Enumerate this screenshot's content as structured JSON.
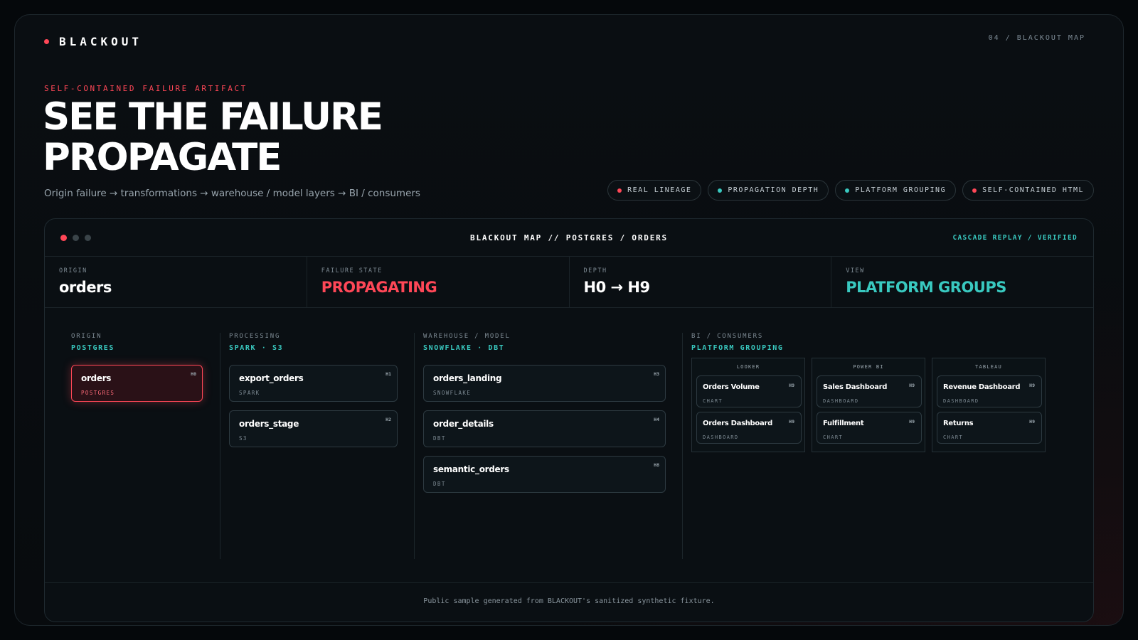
{
  "brand": {
    "name": "BLACKOUT",
    "accent": "#ff4757"
  },
  "page_tag": "04 / BLACKOUT MAP",
  "hero": {
    "eyebrow": "SELF-CONTAINED FAILURE ARTIFACT",
    "title_line1": "SEE THE FAILURE",
    "title_line2": "PROPAGATE",
    "subtitle": "Origin failure → transformations → warehouse / model layers → BI / consumers"
  },
  "pills": [
    {
      "label": "REAL LINEAGE",
      "color": "#ff4757"
    },
    {
      "label": "PROPAGATION DEPTH",
      "color": "#39c9c0"
    },
    {
      "label": "PLATFORM GROUPING",
      "color": "#39c9c0"
    },
    {
      "label": "SELF-CONTAINED HTML",
      "color": "#ff4757"
    }
  ],
  "window": {
    "title": "BLACKOUT MAP // POSTGRES / ORDERS",
    "status": "CASCADE REPLAY / VERIFIED",
    "traffic_colors": [
      "#ff4757",
      "#3a4449",
      "#3a4449"
    ]
  },
  "stats": [
    {
      "label": "ORIGIN",
      "value": "orders",
      "color": "#ffffff"
    },
    {
      "label": "FAILURE STATE",
      "value": "PROPAGATING",
      "color": "#ff4757"
    },
    {
      "label": "DEPTH",
      "value": "H0 → H9",
      "color": "#ffffff"
    },
    {
      "label": "VIEW",
      "value": "PLATFORM GROUPS",
      "color": "#39c9c0"
    }
  ],
  "columns": {
    "origin": {
      "label": "ORIGIN",
      "platform": "POSTGRES",
      "nodes": [
        {
          "name": "orders",
          "type": "POSTGRES",
          "hop": "H0"
        }
      ]
    },
    "processing": {
      "label": "PROCESSING",
      "platform": "SPARK · S3",
      "nodes": [
        {
          "name": "export_orders",
          "type": "SPARK",
          "hop": "H1"
        },
        {
          "name": "orders_stage",
          "type": "S3",
          "hop": "H2"
        }
      ]
    },
    "warehouse": {
      "label": "WAREHOUSE / MODEL",
      "platform": "SNOWFLAKE · DBT",
      "nodes": [
        {
          "name": "orders_landing",
          "type": "SNOWFLAKE",
          "hop": "H3"
        },
        {
          "name": "order_details",
          "type": "DBT",
          "hop": "H4"
        },
        {
          "name": "semantic_orders",
          "type": "DBT",
          "hop": "H8"
        }
      ]
    },
    "bi": {
      "label": "BI / CONSUMERS",
      "platform": "PLATFORM GROUPING",
      "groups": [
        {
          "title": "LOOKER",
          "nodes": [
            {
              "name": "Orders Volume",
              "type": "CHART",
              "hop": "H9"
            },
            {
              "name": "Orders Dashboard",
              "type": "DASHBOARD",
              "hop": "H9"
            }
          ]
        },
        {
          "title": "POWER BI",
          "nodes": [
            {
              "name": "Sales Dashboard",
              "type": "DASHBOARD",
              "hop": "H9"
            },
            {
              "name": "Fulfillment",
              "type": "CHART",
              "hop": "H9"
            }
          ]
        },
        {
          "title": "TABLEAU",
          "nodes": [
            {
              "name": "Revenue Dashboard",
              "type": "DASHBOARD",
              "hop": "H9"
            },
            {
              "name": "Returns",
              "type": "CHART",
              "hop": "H9"
            }
          ]
        }
      ]
    }
  },
  "footer": "Public sample generated from BLACKOUT's sanitized synthetic fixture."
}
